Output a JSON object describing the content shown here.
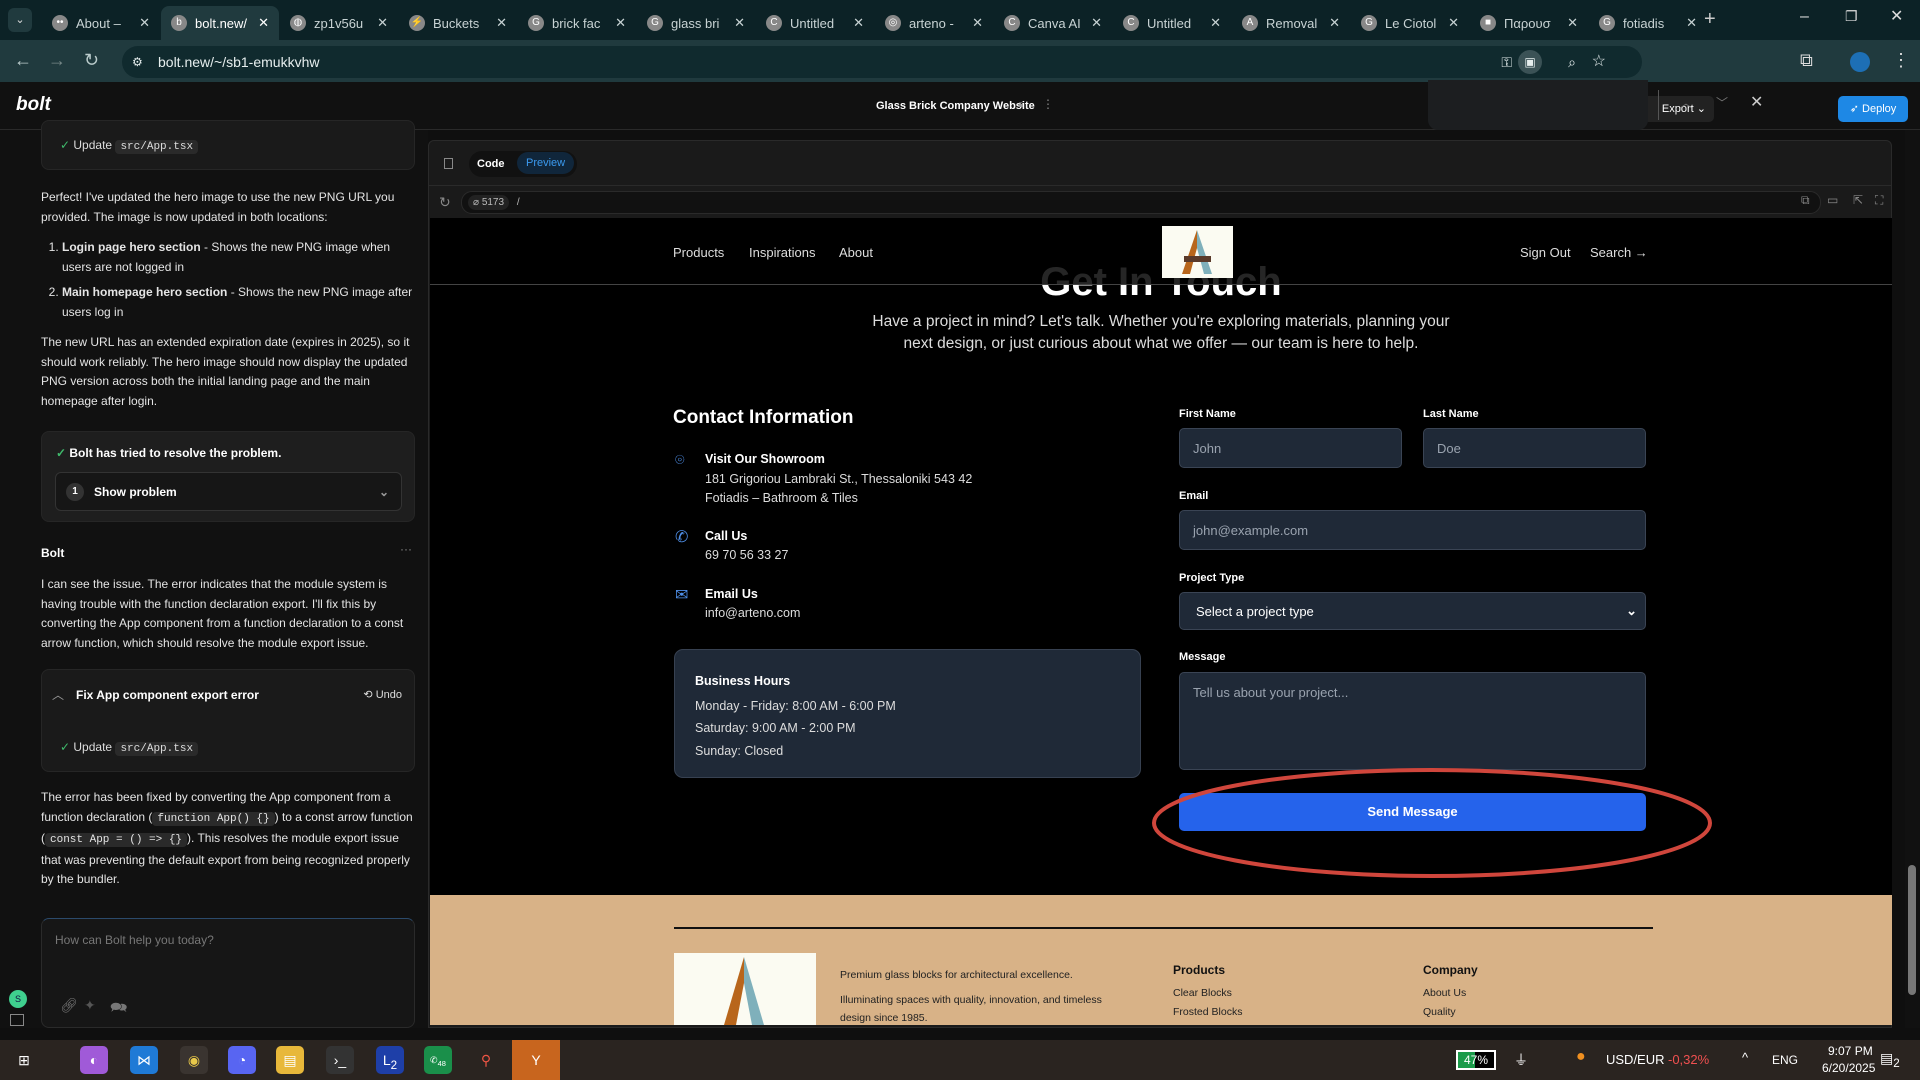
{
  "browser": {
    "tabs": [
      {
        "label": "About –",
        "icon": "••"
      },
      {
        "label": "bolt.new/",
        "icon": "b",
        "active": true
      },
      {
        "label": "zp1v56u",
        "icon": "◍"
      },
      {
        "label": "Buckets",
        "icon": "⚡"
      },
      {
        "label": "brick fac",
        "icon": "G"
      },
      {
        "label": "glass bri",
        "icon": "G"
      },
      {
        "label": "Untitled",
        "icon": "C"
      },
      {
        "label": "arteno -",
        "icon": "◎"
      },
      {
        "label": "Canva AI",
        "icon": "C"
      },
      {
        "label": "Untitled",
        "icon": "C"
      },
      {
        "label": "Removal",
        "icon": "A"
      },
      {
        "label": "Le Ciotol",
        "icon": "G"
      },
      {
        "label": "Παρουσ",
        "icon": "■"
      },
      {
        "label": "fotiadis",
        "icon": "G"
      }
    ],
    "url": "bolt.new/~/sb1-emukkvhw"
  },
  "bolt": {
    "logo": "bolt",
    "project_title": "Glass Brick Company Website",
    "export_label": "Export",
    "deploy_label": "Deploy"
  },
  "chat": {
    "update_label": "Update",
    "file": "src/App.tsx",
    "msg1_p1": "Perfect! I've updated the hero image to use the new PNG URL you provided. The image is now updated in both locations:",
    "list": [
      {
        "bold": "Login page hero section",
        "text": " - Shows the new PNG image when users are not logged in"
      },
      {
        "bold": "Main homepage hero section",
        "text": " - Shows the new PNG image after users log in"
      }
    ],
    "msg1_p2": "The new URL has an extended expiration date (expires in 2025), so it should work reliably. The hero image should now display the updated PNG version across both the initial landing page and the main homepage after login.",
    "resolve_text": "Bolt has tried to resolve the problem.",
    "problem_count": "1",
    "show_problem": "Show problem",
    "author": "Bolt",
    "msg2": "I can see the issue. The error indicates that the module system is having trouble with the function declaration export. I'll fix this by converting the App component from a function declaration to a const arrow function, which should resolve the module export issue.",
    "action_title": "Fix App component export error",
    "undo_label": "Undo",
    "msg3_a": "The error has been fixed by converting the App component from a function declaration (",
    "code1": "function App() {}",
    "msg3_b": ") to a const arrow function (",
    "code2": "const App = () => {}",
    "msg3_c": "). This resolves the module export issue that was preventing the default export from being recognized properly by the bundler.",
    "input_placeholder": "How can Bolt help you today?",
    "avatar": "S"
  },
  "workbench": {
    "tab_code": "Code",
    "tab_preview": "Preview",
    "port": "5173",
    "path": "/"
  },
  "site": {
    "nav": [
      "Products",
      "Inspirations",
      "About"
    ],
    "sign_out": "Sign Out",
    "search": "Search →",
    "heading": "Get In Touch",
    "subtitle": "Have a project in mind? Let's talk. Whether you're exploring materials, planning your next design, or just curious about what we offer — our team is here to help.",
    "contact_title": "Contact Information",
    "items": [
      {
        "title": "Visit Our Showroom",
        "line1": "181 Grigoriou Lambraki St., Thessaloniki 543 42",
        "line2": "Fotiadis – Bathroom & Tiles"
      },
      {
        "title": "Call Us",
        "line1": "69 70 56 33 27"
      },
      {
        "title": "Email Us",
        "line1": "info@arteno.com"
      }
    ],
    "hours": {
      "title": "Business Hours",
      "lines": [
        "Monday - Friday: 8:00 AM - 6:00 PM",
        "Saturday: 9:00 AM - 2:00 PM",
        "Sunday: Closed"
      ]
    },
    "form": {
      "first_label": "First Name",
      "first_ph": "John",
      "last_label": "Last Name",
      "last_ph": "Doe",
      "email_label": "Email",
      "email_ph": "john@example.com",
      "type_label": "Project Type",
      "type_value": "Select a project type",
      "msg_label": "Message",
      "msg_ph": "Tell us about your project...",
      "submit": "Send Message"
    },
    "footer": {
      "tagline": "Premium glass blocks for architectural excellence.",
      "desc": "Illuminating spaces with quality, innovation, and timeless design since 1985.",
      "products_title": "Products",
      "products": [
        "Clear Blocks",
        "Frosted Blocks"
      ],
      "company_title": "Company",
      "company": [
        "About Us",
        "Quality"
      ]
    }
  },
  "taskbar": {
    "battery": "47%",
    "ticker": "USD/EUR",
    "change": "-0,32%",
    "lang": "ENG",
    "time": "9:07 PM",
    "date": "6/20/2025",
    "badge_l": "2",
    "badge_wa": "48",
    "notif": "2"
  },
  "colors": {
    "accent": "#2563eb",
    "footer": "#d8b287",
    "annotation": "#d0463c"
  }
}
